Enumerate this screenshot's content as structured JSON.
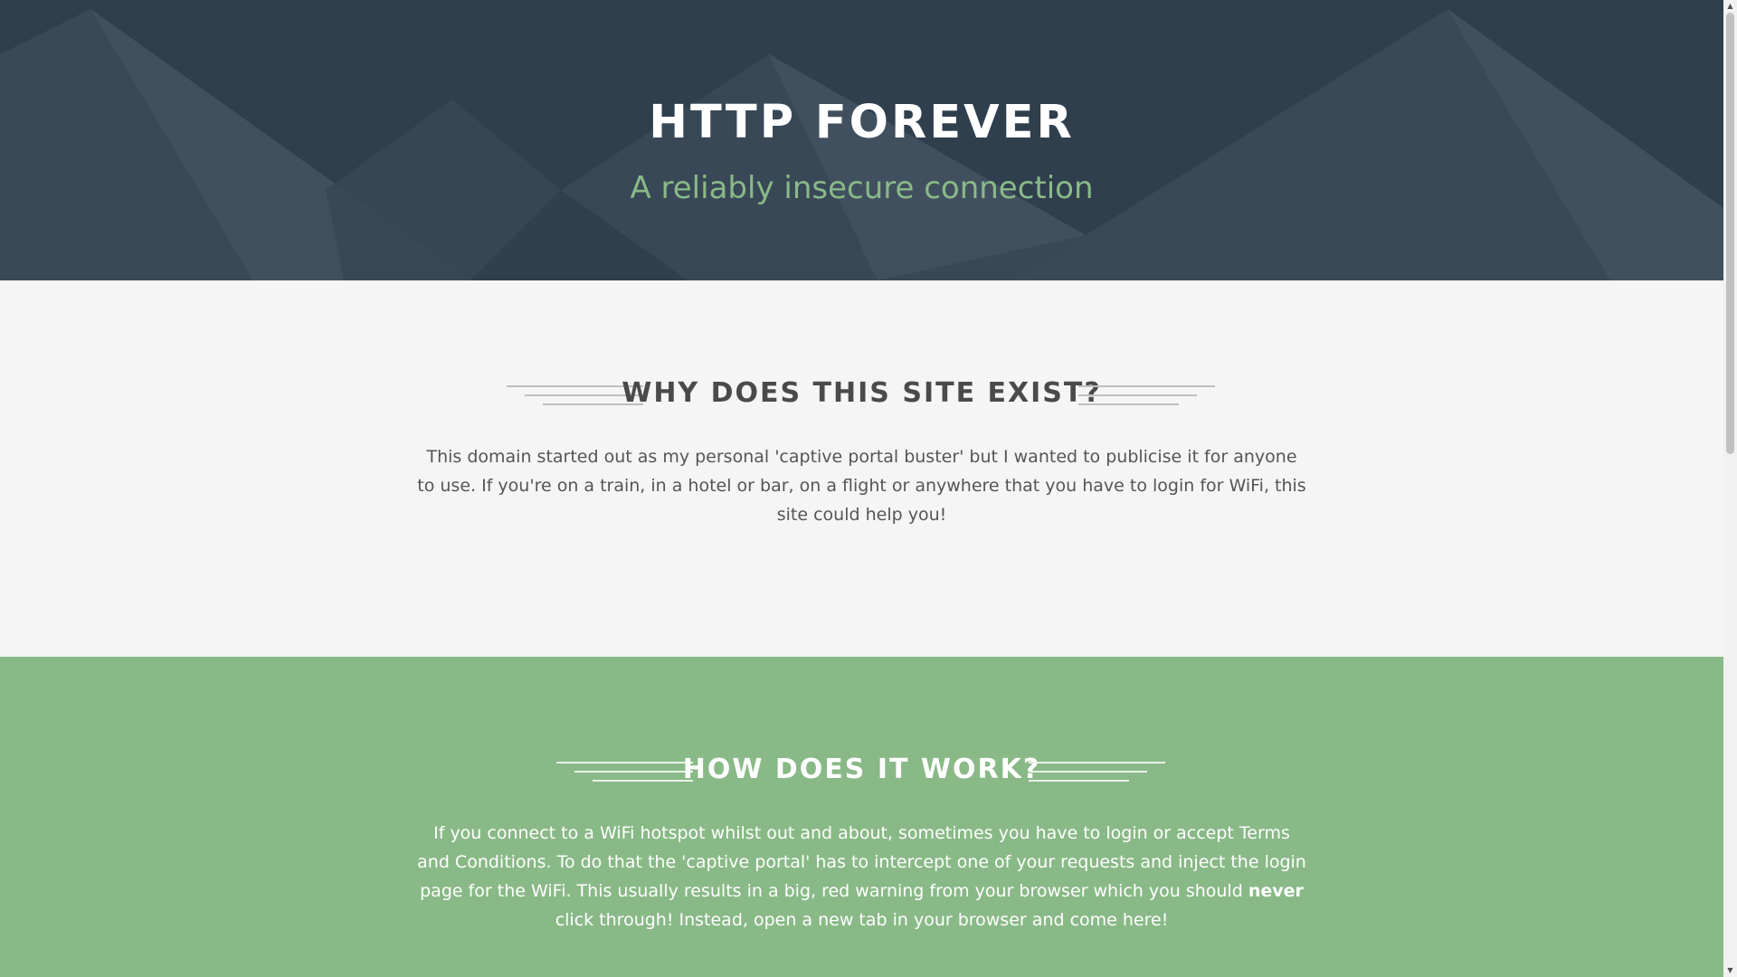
{
  "hero": {
    "title": "HTTP FOREVER",
    "subtitle": "A reliably insecure connection",
    "background_color": "#2f3f4e",
    "subtitle_color": "#8ab987"
  },
  "why_section": {
    "heading": "WHY DOES THIS SITE EXIST?",
    "body": "This domain started out as my personal 'captive portal buster' but I wanted to publicise it for anyone to use. If you're on a train, in a hotel or bar, on a flight or anywhere that you have to login for WiFi, this site could help you!",
    "background_color": "#f5f5f5"
  },
  "how_section": {
    "heading": "HOW DOES IT WORK?",
    "body_before": "If you connect to a WiFi hotspot whilst out and about, sometimes you have to login or accept Terms and Conditions. To do that the 'captive portal' has to intercept one of your requests and inject the login page for the WiFi. This usually results in a big, red warning from your browser which you should ",
    "body_emphasis": "never",
    "body_after": " click through! Instead, open a new tab in your browser and come here!",
    "background_color": "#89b987"
  },
  "scrollbar": {
    "up_icon": "arrow-up-icon",
    "down_icon": "arrow-down-icon"
  }
}
